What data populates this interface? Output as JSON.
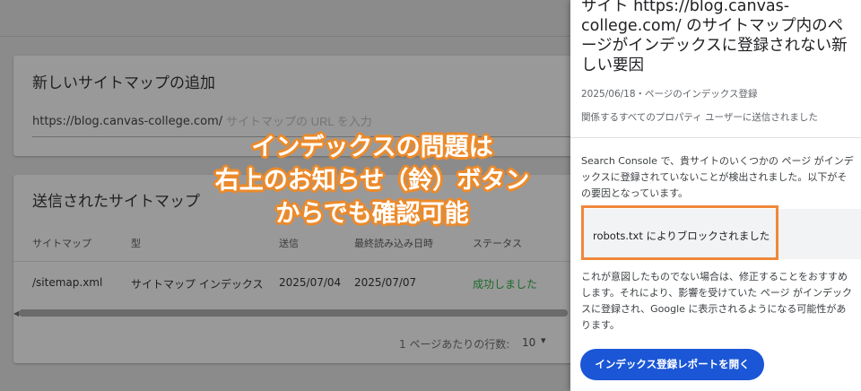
{
  "background": {
    "add_sitemap_card": {
      "title": "新しいサイトマップの追加",
      "url_prefix": "https://blog.canvas-college.com/",
      "input_placeholder": "サイトマップの URL を入力"
    },
    "submitted_card": {
      "title": "送信されたサイトマップ",
      "columns": [
        "サイトマップ",
        "型",
        "送信",
        "最終読み込み日時",
        "ステータス"
      ],
      "rows": [
        {
          "sitemap": "/sitemap.xml",
          "type": "サイトマップ インデックス",
          "submitted": "2025/07/04",
          "last_read": "2025/07/07",
          "status": "成功しました"
        }
      ],
      "rows_per_page_label": "1 ページあたりの行数:",
      "rows_per_page_value": "10"
    }
  },
  "caption": {
    "lines": [
      "インデックスの問題は",
      "右上のお知らせ（鈴）ボタン",
      "からでも確認可能"
    ]
  },
  "notification_panel": {
    "title": "サイト https://blog.canvas-college.com/ のサイトマップ内のページがインデックスに登録されない新しい要因",
    "meta": "2025/06/18・ページのインデックス登録",
    "sent_to": "関係するすべてのプロパティ ユーザーに送信されました",
    "body": "Search Console で、貴サイトのいくつかの ページ がインデックスに登録されていないことが検出されました。以下がその要因となっています。",
    "reason": "robots.txt によりブロックされました",
    "body2": "これが意図したものでない場合は、修正することをおすすめします。それにより、影響を受けていた ページ がインデックスに登録され、Google に表示されるようになる可能性があります。",
    "button_label": "インデックス登録レポートを開く"
  },
  "colors": {
    "highlight_orange": "#f0883a",
    "button_blue": "#1a56d6",
    "status_green": "#1e6b2a"
  }
}
